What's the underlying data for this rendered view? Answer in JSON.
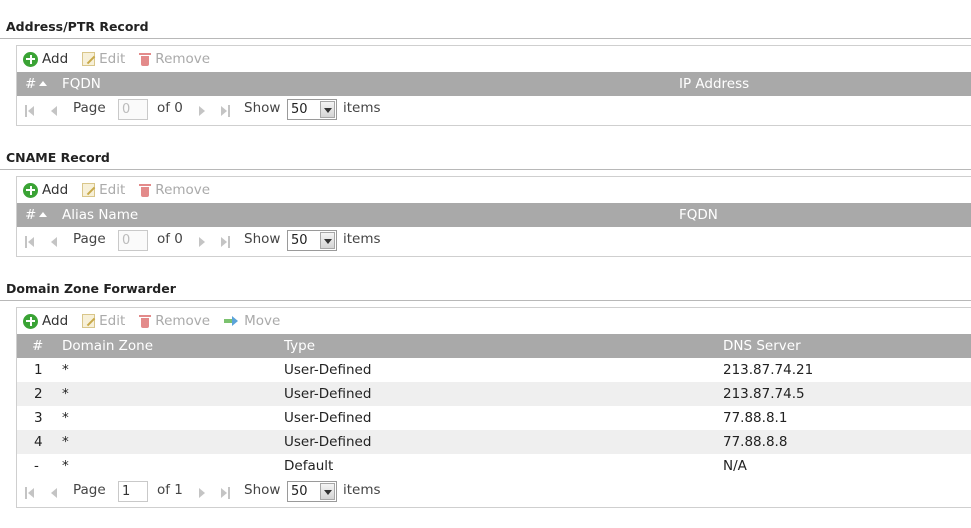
{
  "sections": {
    "ptr": {
      "title": "Address/PTR Record",
      "toolbar": {
        "add": "Add",
        "edit": "Edit",
        "remove": "Remove"
      },
      "columns": {
        "num": "#",
        "fqdn": "FQDN",
        "ip": "IP Address"
      },
      "pager": {
        "page_label": "Page",
        "page_value": "0",
        "of_label": "of 0",
        "show_label": "Show",
        "show_value": "50",
        "items_label": "items"
      }
    },
    "cname": {
      "title": "CNAME Record",
      "toolbar": {
        "add": "Add",
        "edit": "Edit",
        "remove": "Remove"
      },
      "columns": {
        "num": "#",
        "alias": "Alias Name",
        "fqdn": "FQDN"
      },
      "pager": {
        "page_label": "Page",
        "page_value": "0",
        "of_label": "of 0",
        "show_label": "Show",
        "show_value": "50",
        "items_label": "items"
      }
    },
    "dzf": {
      "title": "Domain Zone Forwarder",
      "toolbar": {
        "add": "Add",
        "edit": "Edit",
        "remove": "Remove",
        "move": "Move"
      },
      "columns": {
        "num": "#",
        "zone": "Domain Zone",
        "type": "Type",
        "dns": "DNS Server"
      },
      "rows": [
        {
          "num": "1",
          "zone": "*",
          "type": "User-Defined",
          "dns": "213.87.74.21"
        },
        {
          "num": "2",
          "zone": "*",
          "type": "User-Defined",
          "dns": "213.87.74.5"
        },
        {
          "num": "3",
          "zone": "*",
          "type": "User-Defined",
          "dns": "77.88.8.1"
        },
        {
          "num": "4",
          "zone": "*",
          "type": "User-Defined",
          "dns": "77.88.8.8"
        },
        {
          "num": "-",
          "zone": "*",
          "type": "Default",
          "dns": "N/A"
        }
      ],
      "pager": {
        "page_label": "Page",
        "page_value": "1",
        "of_label": "of 1",
        "show_label": "Show",
        "show_value": "50",
        "items_label": "items"
      }
    }
  },
  "colors": {
    "header_bg": "#a9a9a9",
    "add_icon": "#3aa335",
    "alt_row": "#efefef"
  },
  "icons": {
    "add": "add-circle-icon",
    "edit": "edit-pencil-icon",
    "remove": "trash-icon",
    "move": "move-arrow-icon",
    "first": "first-page-icon",
    "prev": "prev-page-icon",
    "next": "next-page-icon",
    "last": "last-page-icon",
    "dropdown": "chevron-down-icon"
  }
}
